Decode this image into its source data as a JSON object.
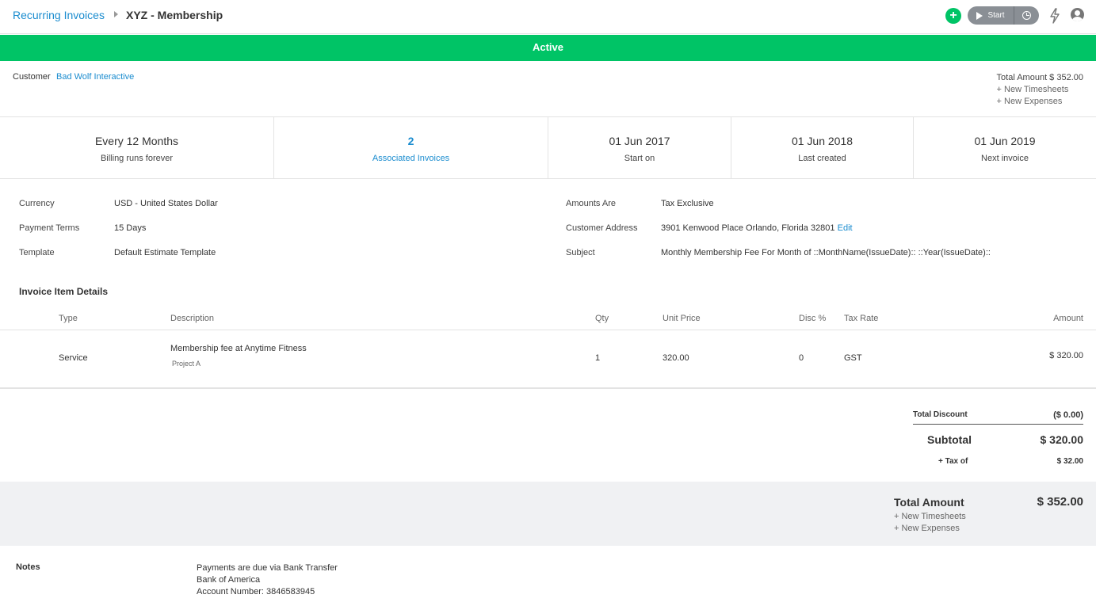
{
  "header": {
    "breadcrumb_link": "Recurring Invoices",
    "title": "XYZ - Membership",
    "start_label": "Start",
    "icons": [
      "add-icon",
      "play-icon",
      "clock-icon",
      "lightning-icon",
      "user-icon"
    ]
  },
  "status": {
    "label": "Active",
    "color": "#00c466"
  },
  "customer": {
    "label": "Customer",
    "name": "Bad Wolf Interactive",
    "total_amount": "Total Amount $ 352.00",
    "new_timesheets": "+ New Timesheets",
    "new_expenses": "+ New Expenses"
  },
  "stats": [
    {
      "value": "Every 12 Months",
      "label": "Billing runs forever"
    },
    {
      "value": "2",
      "label": "Associated Invoices"
    },
    {
      "value": "01 Jun 2017",
      "label": "Start on"
    },
    {
      "value": "01 Jun 2018",
      "label": "Last created"
    },
    {
      "value": "01 Jun 2019",
      "label": "Next invoice"
    }
  ],
  "details_left": [
    {
      "label": "Currency",
      "value": "USD - United States Dollar"
    },
    {
      "label": "Payment Terms",
      "value": "15 Days"
    },
    {
      "label": "Template",
      "value": "Default Estimate Template"
    }
  ],
  "details_right": [
    {
      "label": "Amounts Are",
      "value": "Tax Exclusive"
    },
    {
      "label": "Customer Address",
      "value": "3901 Kenwood Place Orlando, Florida 32801",
      "action": "Edit"
    },
    {
      "label": "Subject",
      "value": "Monthly Membership Fee For Month of ::MonthName(IssueDate):: ::Year(IssueDate)::"
    }
  ],
  "items": {
    "title": "Invoice Item Details",
    "columns": [
      "Type",
      "Description",
      "Qty",
      "Unit Price",
      "Disc %",
      "Tax Rate",
      "Amount"
    ],
    "rows": [
      {
        "type": "Service",
        "description": "Membership fee at Anytime Fitness",
        "project": "Project A",
        "qty": "1",
        "unit_price": "320.00",
        "disc": "0",
        "tax_rate": "GST",
        "amount": "$ 320.00"
      }
    ]
  },
  "totals": {
    "discount_label": "Total Discount",
    "discount_value": "($ 0.00)",
    "subtotal_label": "Subtotal",
    "subtotal_value": "$ 320.00",
    "tax_label": "+ Tax of",
    "tax_value": "$ 32.00",
    "total_label": "Total Amount",
    "total_value": "$ 352.00",
    "new_timesheets": "+ New Timesheets",
    "new_expenses": "+ New Expenses"
  },
  "notes": {
    "label": "Notes",
    "lines": [
      "Payments are due via Bank Transfer",
      "Bank of America",
      "Account Number: 3846583945"
    ]
  }
}
